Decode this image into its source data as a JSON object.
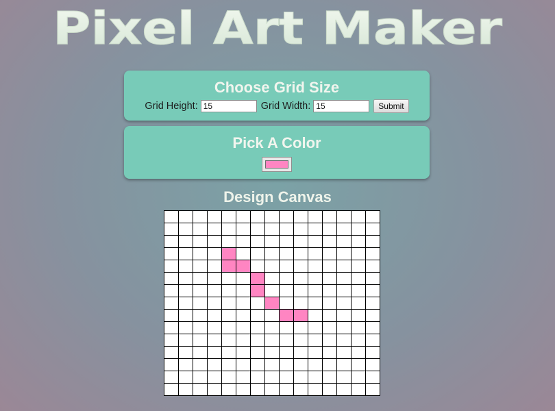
{
  "header": {
    "logo_text": "Pixel Art Maker"
  },
  "grid_size": {
    "heading": "Choose Grid Size",
    "height_label": "Grid Height:",
    "height_value": "15",
    "width_label": "Grid Width:",
    "width_value": "15",
    "submit_label": "Submit"
  },
  "color_picker": {
    "heading": "Pick A Color",
    "selected_color": "#ff85c2"
  },
  "canvas": {
    "heading": "Design Canvas",
    "rows": 15,
    "cols": 15,
    "empty_color": "#ffffff",
    "filled_cells": [
      [
        3,
        4
      ],
      [
        4,
        4
      ],
      [
        4,
        5
      ],
      [
        5,
        6
      ],
      [
        6,
        6
      ],
      [
        7,
        7
      ],
      [
        8,
        8
      ],
      [
        8,
        9
      ]
    ]
  },
  "colors": {
    "panel": "#78cbb8",
    "heading_text": "#f1f5ee",
    "logo": "#e3efe1"
  }
}
